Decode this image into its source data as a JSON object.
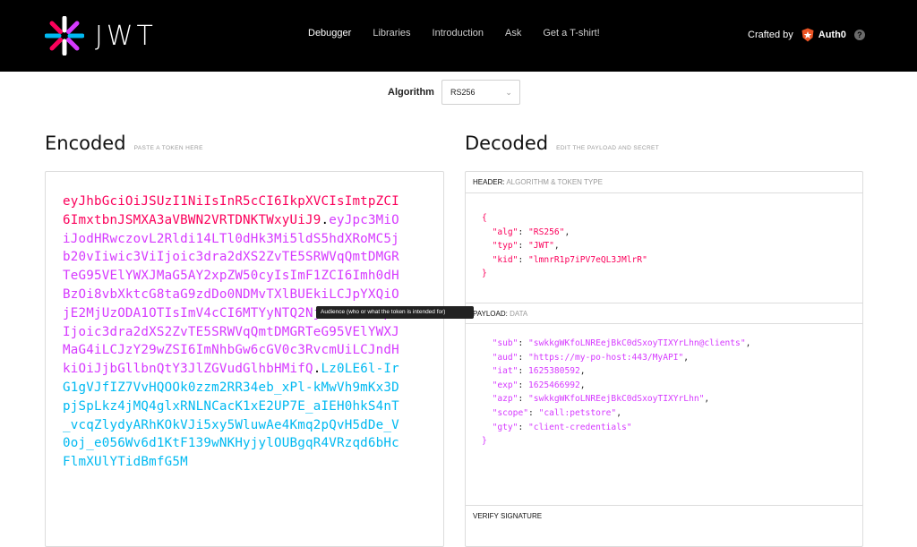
{
  "nav": {
    "logo_text": "JWT",
    "links": [
      "Debugger",
      "Libraries",
      "Introduction",
      "Ask",
      "Get a T-shirt!"
    ],
    "active": "Debugger",
    "crafted_label": "Crafted by",
    "brand_label": "Auth0",
    "help_glyph": "?"
  },
  "algorithm": {
    "label": "Algorithm",
    "selected": "RS256"
  },
  "encoded": {
    "title": "Encoded",
    "hint": "PASTE A TOKEN HERE",
    "token_header": "eyJhbGciOiJSUzI1NiIsInR5cCI6IkpXVCIsImtpZCI6ImxtbnJSMXA3aVBWN2VRTDNKTWxyUiJ9",
    "token_payload": "eyJpc3MiOiJodHRwczovL2Rldi14LTl0dHk3Mi5ldS5hdXRoMC5jb20vIiwic3ViIjoic3dra2dXS2ZvTE5SRWVqQmtDMGRTeG95VElYWXJMaG5AY2xpZW50cyIsImF1ZCI6Imh0dHBzOi8vbXktcG8taG9zdDo0NDMvTXlBUEkiLCJpYXQiOjE2MjUzODA1OTIsImV4cCI6MTYyNTQ2Njk5MiwiYXpwIjoic3dra2dXS2ZvTE5SRWVqQmtDMGRTeG95VElYWXJMaG4iLCJzY29wZSI6ImNhbGw6cGV0c3RvcmUiLCJndHkiOiJjbGllbnQtY3JlZGVudGlhbHMifQ",
    "token_signature": "Lz0LE6l-IrG1gVJfIZ7VvHQOOk0zzm2RR34eb_xPl-kMwVh9mKx3DpjSpLkz4jMQ4glxRNLNCacK1xE2UP7E_aIEH0hkS4nT_vcqZlydyARhKOkVJi5xy5WluwAe4Kmq2pQvH5dDe_V0oj_e056Wv6d1KtF139wNKHyjylOUBgqR4VRzqd6bHcFlmXUlYTidBmfG5M"
  },
  "tooltip": {
    "text": "Audience (who or what the token is intended for)"
  },
  "decoded": {
    "title": "Decoded",
    "hint": "EDIT THE PAYLOAD AND SECRET",
    "header_section": {
      "label": "HEADER:",
      "sub": "ALGORITHM & TOKEN TYPE"
    },
    "payload_section": {
      "label": "PAYLOAD:",
      "sub": "DATA"
    },
    "verify_section": {
      "label": "VERIFY SIGNATURE"
    },
    "header_json": [
      {
        "key": "alg",
        "value": "RS256"
      },
      {
        "key": "typ",
        "value": "JWT"
      },
      {
        "key": "kid",
        "value": "lmnrR1p7iPV7eQL3JMlrR"
      }
    ],
    "payload_json": [
      {
        "key": "sub",
        "value": "swkkgWKfoLNREejBkC0dSxoyTIXYrLhn@clients",
        "type": "string"
      },
      {
        "key": "aud",
        "value": "https://my-po-host:443/MyAPI",
        "type": "string"
      },
      {
        "key": "iat",
        "value": "1625380592",
        "type": "number"
      },
      {
        "key": "exp",
        "value": "1625466992",
        "type": "number"
      },
      {
        "key": "azp",
        "value": "swkkgWKfoLNREejBkC0dSxoyTIXYrLhn",
        "type": "string"
      },
      {
        "key": "scope",
        "value": "call:petstore",
        "type": "string"
      },
      {
        "key": "gty",
        "value": "client-credentials",
        "type": "string"
      }
    ]
  },
  "colors": {
    "header_red": "#fb015b",
    "payload_purple": "#d63aff",
    "signature_blue": "#00b9f1",
    "topbar_black": "#000000"
  }
}
